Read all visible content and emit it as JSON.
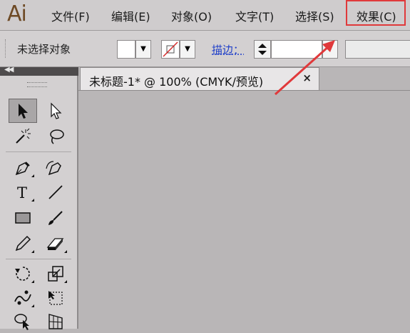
{
  "app": {
    "logo": "Ai"
  },
  "menubar": {
    "items": [
      {
        "label": "文件(F)"
      },
      {
        "label": "编辑(E)"
      },
      {
        "label": "对象(O)"
      },
      {
        "label": "文字(T)"
      },
      {
        "label": "选择(S)"
      },
      {
        "label": "效果(C)",
        "highlighted": true
      }
    ]
  },
  "controlbar": {
    "selection_label": "未选择对象",
    "stroke_label": "描边："
  },
  "document": {
    "tab_title": "未标题-1* @ 100% (CMYK/预览)",
    "close_glyph": "×"
  },
  "tools": [
    {
      "name": "selection-tool",
      "active": true
    },
    {
      "name": "direct-selection-tool"
    },
    {
      "name": "magic-wand-tool"
    },
    {
      "name": "lasso-tool"
    },
    {
      "name": "pen-tool"
    },
    {
      "name": "curvature-tool"
    },
    {
      "name": "type-tool"
    },
    {
      "name": "line-segment-tool"
    },
    {
      "name": "rectangle-tool"
    },
    {
      "name": "paintbrush-tool"
    },
    {
      "name": "pencil-tool"
    },
    {
      "name": "eraser-tool"
    },
    {
      "name": "rotate-tool"
    },
    {
      "name": "scale-tool"
    },
    {
      "name": "warp-tool"
    },
    {
      "name": "free-transform-tool"
    },
    {
      "name": "shape-builder-tool"
    },
    {
      "name": "perspective-grid-tool"
    }
  ],
  "colors": {
    "menu_highlight": "#e0393b",
    "annotation_arrow": "#e0393b",
    "stroke_link": "#1f3fc9",
    "logo": "#6e4a25"
  }
}
